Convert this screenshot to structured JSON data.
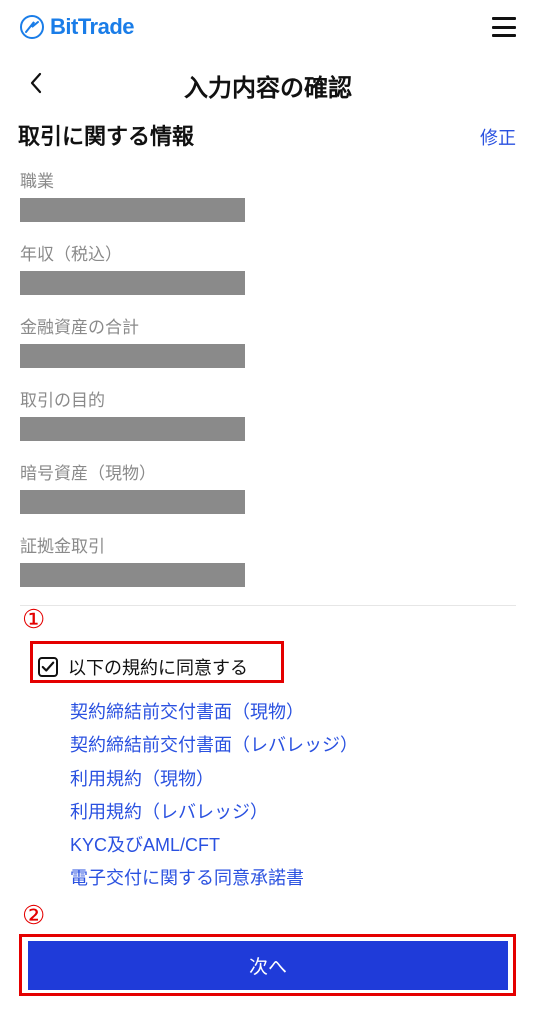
{
  "brand": "BitTrade",
  "page_title": "入力内容の確認",
  "section": {
    "title": "取引に関する情報",
    "edit": "修正"
  },
  "fields": [
    {
      "label": "職業"
    },
    {
      "label": "年収（税込）"
    },
    {
      "label": "金融資産の合計"
    },
    {
      "label": "取引の目的"
    },
    {
      "label": "暗号資産（現物）"
    },
    {
      "label": "証拠金取引"
    }
  ],
  "consent": {
    "checked": true,
    "label": "以下の規約に同意する"
  },
  "documents": [
    "契約締結前交付書面（現物）",
    "契約締結前交付書面（レバレッジ）",
    "利用規約（現物）",
    "利用規約（レバレッジ）",
    "KYC及びAML/CFT",
    "電子交付に関する同意承諾書"
  ],
  "next": "次へ",
  "callouts": {
    "one": "①",
    "two": "②"
  },
  "colors": {
    "brand": "#1a7de8",
    "primary_button": "#1f3bd9",
    "link": "#2a51e0",
    "annotation": "#e40000",
    "redacted": "#8a8a8a"
  }
}
